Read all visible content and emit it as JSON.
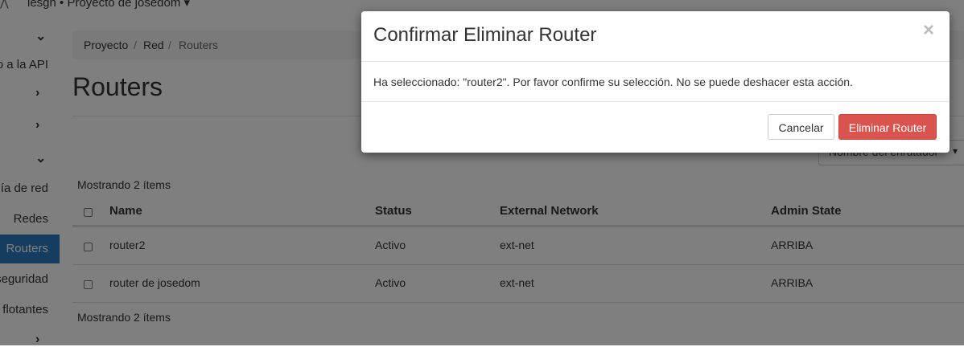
{
  "topbar": {
    "project_label": "lesgh • Proyecto de josedom ▾"
  },
  "sidebar": {
    "items": [
      {
        "label": "",
        "icon": "chevron-down-icon"
      },
      {
        "label": "o a la API"
      },
      {
        "label": "",
        "icon": "chevron-right-icon"
      },
      {
        "label": "",
        "icon": "chevron-right-icon"
      },
      {
        "label": "",
        "icon": "chevron-down-icon"
      },
      {
        "label": "gía de red"
      },
      {
        "label": "Redes"
      },
      {
        "label": "Routers",
        "active": true
      },
      {
        "label": "seguridad"
      },
      {
        "label": "flotantes"
      },
      {
        "label": "",
        "icon": "chevron-right-icon"
      }
    ]
  },
  "breadcrumb": [
    "Proyecto",
    "Red",
    "Routers"
  ],
  "page_title": "Routers",
  "filter": {
    "selected": "Nombre del enrutador"
  },
  "table": {
    "count_text": "Mostrando 2 ítems",
    "columns": [
      "Name",
      "Status",
      "External Network",
      "Admin State"
    ],
    "rows": [
      {
        "name": "router2",
        "status": "Activo",
        "external_network": "ext-net",
        "admin_state": "ARRIBA"
      },
      {
        "name": "router de josedom",
        "status": "Activo",
        "external_network": "ext-net",
        "admin_state": "ARRIBA"
      }
    ]
  },
  "modal": {
    "title": "Confirmar Eliminar Router",
    "close": "×",
    "message": "Ha seleccionado: \"router2\". Por favor confirme su selección. No se puede deshacer esta acción.",
    "cancel_label": "Cancelar",
    "confirm_label": "Eliminar Router"
  },
  "colors": {
    "danger": "#d9534f",
    "link": "#2a7bbf",
    "active_nav": "#2a7bbf"
  }
}
